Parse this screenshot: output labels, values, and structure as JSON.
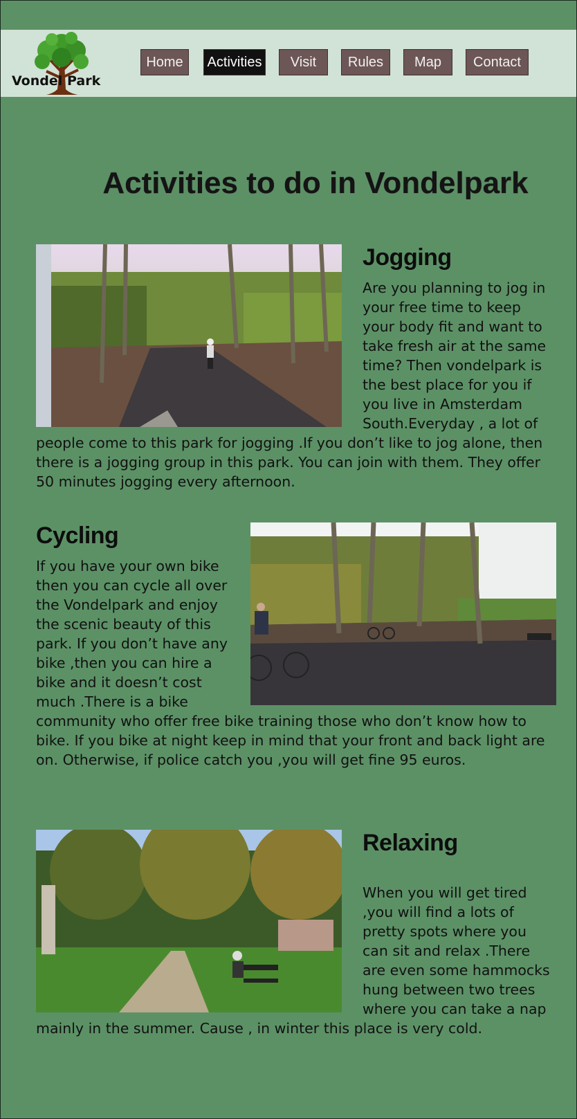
{
  "logo": {
    "word1": "Vondel",
    "word2": "Park"
  },
  "nav": {
    "items": [
      {
        "label": "Home",
        "active": false
      },
      {
        "label": "Activities",
        "active": true
      },
      {
        "label": "Visit",
        "active": false
      },
      {
        "label": "Rules",
        "active": false
      },
      {
        "label": "Map",
        "active": false
      },
      {
        "label": "Contact",
        "active": false
      }
    ]
  },
  "page_title": "Activities to do in Vondelpark",
  "sections": [
    {
      "heading": "Jogging",
      "text": "Are you planning to jog in your free time to keep your body fit and want to take fresh air at the same time? Then vondelpark is the best place for you if you live in Amsterdam South.Everyday , a lot of people come to this park for jogging .If you don’t like to jog alone, then there is a jogging group in this park. You can join with them. They offer 50 minutes  jogging every afternoon."
    },
    {
      "heading": "Cycling",
      "text": "If you have your own bike then you can cycle all over the Vondelpark and enjoy the scenic beauty of this park. If you don’t have any bike ,then you can hire a bike and it doesn’t cost much .There is a bike community who offer free bike training those who don’t know how to bike. If you bike at night keep in mind that your front and back light are on. Otherwise, if police catch you ,you will get fine 95 euros."
    },
    {
      "heading": "Relaxing",
      "text": "When you will get tired ,you will find a lots of pretty spots where you can sit and relax .There are even some hammocks hung between two trees where you can take a nap mainly in the summer. Cause , in winter this place is very cold."
    }
  ],
  "colors": {
    "page_bg": "#5c9166",
    "header_bg": "#d1e2d6",
    "nav_button": "#6c5656",
    "nav_active": "#111111"
  }
}
